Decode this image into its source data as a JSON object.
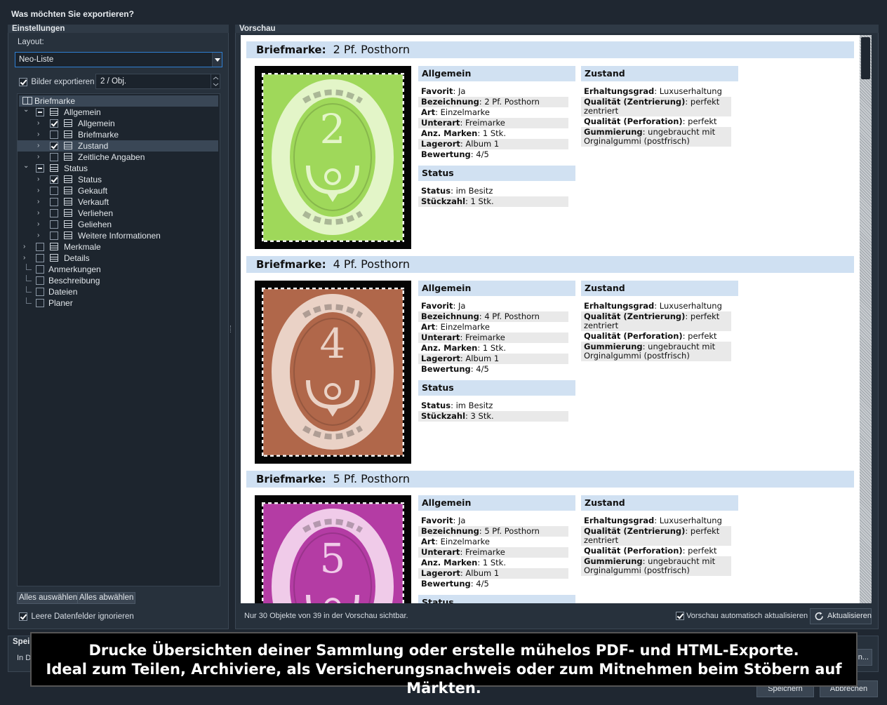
{
  "window": {
    "title": "Was möchten Sie exportieren?"
  },
  "settings": {
    "group_label": "Einstellungen",
    "layout_label": "Layout:",
    "layout_value": "Neo-Liste",
    "images_label": "Bilder exportieren",
    "images_value": "2 / Obj.",
    "select_all": "Alles auswählen",
    "deselect_all": "Alles abwählen",
    "ignore_empty": "Leere Datenfelder ignorieren",
    "tree": [
      {
        "label": "Briefmarke",
        "level": 0,
        "root": true
      },
      {
        "label": "Allgemein",
        "level": 1,
        "expander": "v",
        "check": "partial"
      },
      {
        "label": "Allgemein",
        "level": 2,
        "expander": ">",
        "check": "on"
      },
      {
        "label": "Briefmarke",
        "level": 2,
        "expander": ">",
        "check": "off"
      },
      {
        "label": "Zustand",
        "level": 2,
        "expander": ">",
        "check": "on",
        "selected": true
      },
      {
        "label": "Zeitliche Angaben",
        "level": 2,
        "expander": ">",
        "check": "off"
      },
      {
        "label": "Status",
        "level": 1,
        "expander": "v",
        "check": "partial"
      },
      {
        "label": "Status",
        "level": 2,
        "expander": ">",
        "check": "on"
      },
      {
        "label": "Gekauft",
        "level": 2,
        "expander": ">",
        "check": "off"
      },
      {
        "label": "Verkauft",
        "level": 2,
        "expander": ">",
        "check": "off"
      },
      {
        "label": "Verliehen",
        "level": 2,
        "expander": ">",
        "check": "off"
      },
      {
        "label": "Geliehen",
        "level": 2,
        "expander": ">",
        "check": "off"
      },
      {
        "label": "Weitere Informationen",
        "level": 2,
        "expander": ">",
        "check": "off"
      },
      {
        "label": "Merkmale",
        "level": 1,
        "expander": ">",
        "check": "off"
      },
      {
        "label": "Details",
        "level": 1,
        "expander": ">",
        "check": "off"
      },
      {
        "label": "Anmerkungen",
        "level": 1,
        "check": "off",
        "noicon": true
      },
      {
        "label": "Beschreibung",
        "level": 1,
        "check": "off",
        "noicon": true
      },
      {
        "label": "Dateien",
        "level": 1,
        "check": "off",
        "noicon": true
      },
      {
        "label": "Planer",
        "level": 1,
        "check": "off",
        "noicon": true
      }
    ]
  },
  "preview": {
    "group_label": "Vorschau",
    "status_text": "Nur 30 Objekte von 39 in der Vorschau sichtbar.",
    "auto_update_label": "Vorschau automatisch aktualisieren",
    "refresh_label": "Aktualisieren",
    "items": [
      {
        "type_label": "Briefmarke:",
        "title": "2 Pf. Posthorn",
        "digit": "2",
        "stamp_color": "#9fd85a",
        "frame_color": "#e3f5c8",
        "allgemein_title": "Allgemein",
        "allgemein": [
          [
            "Favorit",
            "Ja"
          ],
          [
            "Bezeichnung",
            "2 Pf. Posthorn"
          ],
          [
            "Art",
            "Einzelmarke"
          ],
          [
            "Unterart",
            "Freimarke"
          ],
          [
            "Anz. Marken",
            "1 Stk."
          ],
          [
            "Lagerort",
            "Album 1"
          ],
          [
            "Bewertung",
            "4/5"
          ]
        ],
        "status_title": "Status",
        "status": [
          [
            "Status",
            "im Besitz"
          ],
          [
            "Stückzahl",
            "1 Stk."
          ]
        ],
        "zustand_title": "Zustand",
        "zustand": [
          [
            "Erhaltungsgrad",
            "Luxuserhaltung"
          ],
          [
            "Qualität (Zentrierung)",
            "perfekt zentriert"
          ],
          [
            "Qualität (Perforation)",
            "perfekt"
          ],
          [
            "Gummierung",
            "ungebraucht mit Orginalgummi (postfrisch)"
          ]
        ]
      },
      {
        "type_label": "Briefmarke:",
        "title": "4 Pf. Posthorn",
        "digit": "4",
        "stamp_color": "#b0674a",
        "frame_color": "#ead2c6",
        "allgemein_title": "Allgemein",
        "allgemein": [
          [
            "Favorit",
            "Ja"
          ],
          [
            "Bezeichnung",
            "4 Pf. Posthorn"
          ],
          [
            "Art",
            "Einzelmarke"
          ],
          [
            "Unterart",
            "Freimarke"
          ],
          [
            "Anz. Marken",
            "1 Stk."
          ],
          [
            "Lagerort",
            "Album 1"
          ],
          [
            "Bewertung",
            "4/5"
          ]
        ],
        "status_title": "Status",
        "status": [
          [
            "Status",
            "im Besitz"
          ],
          [
            "Stückzahl",
            "3 Stk."
          ]
        ],
        "zustand_title": "Zustand",
        "zustand": [
          [
            "Erhaltungsgrad",
            "Luxuserhaltung"
          ],
          [
            "Qualität (Zentrierung)",
            "perfekt zentriert"
          ],
          [
            "Qualität (Perforation)",
            "perfekt"
          ],
          [
            "Gummierung",
            "ungebraucht mit Orginalgummi (postfrisch)"
          ]
        ]
      },
      {
        "type_label": "Briefmarke:",
        "title": "5 Pf. Posthorn",
        "digit": "5",
        "stamp_color": "#b43ca4",
        "frame_color": "#f0cbe9",
        "allgemein_title": "Allgemein",
        "allgemein": [
          [
            "Favorit",
            "Ja"
          ],
          [
            "Bezeichnung",
            "5 Pf. Posthorn"
          ],
          [
            "Art",
            "Einzelmarke"
          ],
          [
            "Unterart",
            "Freimarke"
          ],
          [
            "Anz. Marken",
            "1 Stk."
          ],
          [
            "Lagerort",
            "Album 1"
          ],
          [
            "Bewertung",
            "4/5"
          ]
        ],
        "status_title": "Status",
        "status": [],
        "zustand_title": "Zustand",
        "zustand": [
          [
            "Erhaltungsgrad",
            "Luxuserhaltung"
          ],
          [
            "Qualität (Zentrierung)",
            "perfekt zentriert"
          ],
          [
            "Qualität (Perforation)",
            "perfekt"
          ],
          [
            "Gummierung",
            "ungebraucht mit Orginalgummi (postfrisch)"
          ]
        ]
      }
    ]
  },
  "save": {
    "group_label": "Spei",
    "row_label": "In D",
    "browse_label": "n...",
    "save_button": "Speichern",
    "cancel_button": "Abbrechen"
  },
  "banner": {
    "line1": "Drucke Übersichten deiner Sammlung oder erstelle mühelos PDF- und HTML-Exporte.",
    "line2": "Ideal zum Teilen, Archiviere, als Versicherungsnachweis oder zum Mitnehmen beim Stöbern auf Märkten."
  }
}
